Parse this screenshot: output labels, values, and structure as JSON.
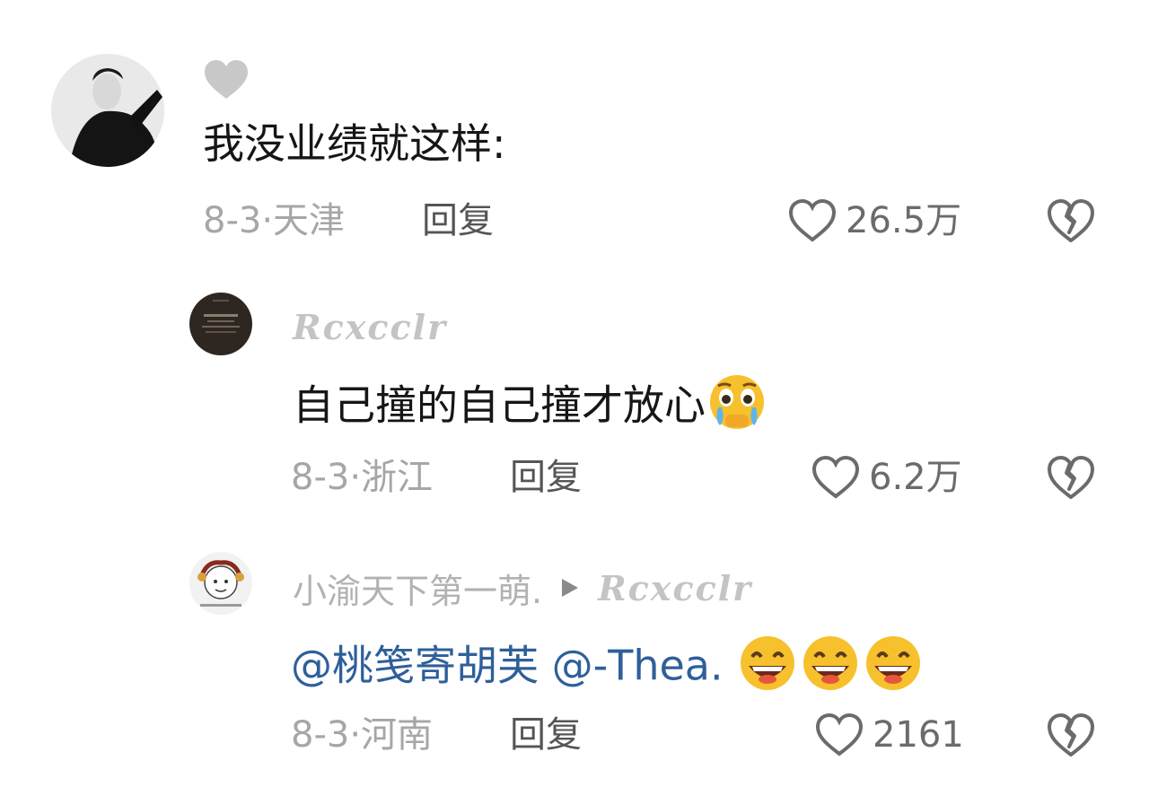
{
  "comments": [
    {
      "username": "",
      "avatar_icon": "woman-in-black-avatar-icon",
      "text": "我没业绩就这样:",
      "date_location": "8-3·天津",
      "reply_label": "回复",
      "likes": "26.5万"
    },
    {
      "username": "Rcxcclr",
      "avatar_icon": "dark-music-avatar-icon",
      "text": "自己撞的自己撞才放心",
      "emoji": "crying-face-emoji",
      "date_location": "8-3·浙江",
      "reply_label": "回复",
      "likes": "6.2万"
    },
    {
      "username": "小渝天下第一萌.",
      "reply_to": "Rcxcclr",
      "avatar_icon": "cartoon-character-avatar-icon",
      "mention1": "@桃笺寄胡芙",
      "mention2": "@-Thea.",
      "emoji": "grinning-face-emoji",
      "emoji_count": 3,
      "date_location": "8-3·河南",
      "reply_label": "回复",
      "likes": "2161"
    }
  ],
  "colors": {
    "text": "#161616",
    "meta": "#a6a6a6",
    "mention": "#2f5f9a",
    "icon": "#6b6b6b"
  }
}
